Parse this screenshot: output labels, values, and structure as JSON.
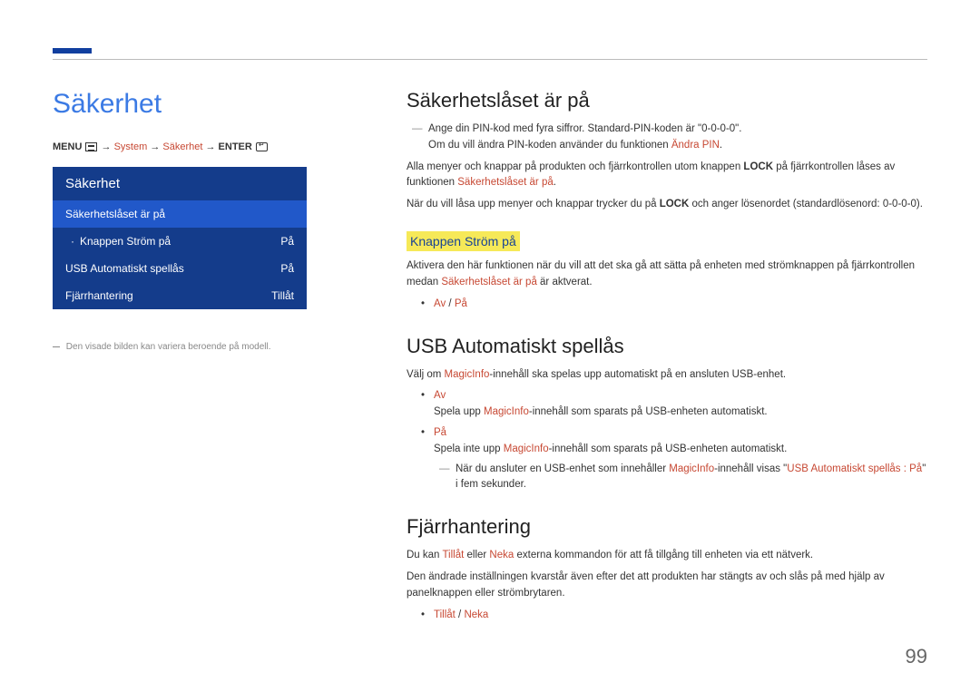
{
  "page": {
    "number": "99"
  },
  "left": {
    "heading": "Säkerhet",
    "breadcrumb": {
      "menu": "MENU",
      "arrow": " → ",
      "system": "System",
      "sakerhet": "Säkerhet",
      "enter": "ENTER"
    },
    "ui": {
      "title": "Säkerhet",
      "rows": {
        "lock_on": "Säkerhetslåset är på",
        "power_btn": {
          "label": "Knappen Ström på",
          "value": "På"
        },
        "usb": {
          "label": "USB Automatiskt spellås",
          "value": "På"
        },
        "remote": {
          "label": "Fjärrhantering",
          "value": "Tillåt"
        }
      }
    },
    "footnote": "Den visade bilden kan variera beroende på modell."
  },
  "right": {
    "section1": {
      "title": "Säkerhetslåset är på",
      "note1_part1": "Ange din PIN-kod med fyra siffror. Standard-PIN-koden är \"0-0-0-0\".",
      "note1_part2a": "Om du vill ändra PIN-koden använder du funktionen ",
      "note1_part2b": "Ändra PIN",
      "note1_part2c": ".",
      "p1a": "Alla menyer och knappar på produkten och fjärrkontrollen utom knappen ",
      "p1b": "LOCK",
      "p1c": " på fjärrkontrollen låses av funktionen ",
      "p1d": "Säkerhetslåset är på",
      "p1e": ".",
      "p2a": "När du vill låsa upp menyer och knappar trycker du på ",
      "p2b": "LOCK",
      "p2c": " och anger lösenordet (standardlösenord: 0-0-0-0).",
      "sub": {
        "title": "Knappen Ström på",
        "p1a": "Aktivera den här funktionen när du vill att det ska gå att sätta på enheten med strömknappen på fjärrkontrollen medan ",
        "p1b": "Säkerhetslåset är på",
        "p1c": " är aktverat.",
        "opts": {
          "av": "Av",
          "slash": " / ",
          "pa": "På"
        }
      }
    },
    "section2": {
      "title": "USB Automatiskt spellås",
      "p1a": "Välj om ",
      "p1b": "MagicInfo",
      "p1c": "-innehåll ska spelas upp automatiskt på en ansluten USB-enhet.",
      "item_av": {
        "label": "Av",
        "desc_a": "Spela upp ",
        "desc_b": "MagicInfo",
        "desc_c": "-innehåll som sparats på USB-enheten automatiskt."
      },
      "item_pa": {
        "label": "På",
        "desc_a": "Spela inte upp ",
        "desc_b": "MagicInfo",
        "desc_c": "-innehåll som sparats på USB-enheten automatiskt.",
        "note_a": "När du ansluter en USB-enhet som innehåller ",
        "note_b": "MagicInfo",
        "note_c": "-innehåll visas \"",
        "note_d": "USB Automatiskt spellås : På",
        "note_e": "\" i fem sekunder."
      }
    },
    "section3": {
      "title": "Fjärrhantering",
      "p1a": "Du kan ",
      "p1b": "Tillåt",
      "p1c": " eller ",
      "p1d": "Neka",
      "p1e": " externa kommandon för att få tillgång till enheten via ett nätverk.",
      "p2": "Den ändrade inställningen kvarstår även efter det att produkten har stängts av och slås på med hjälp av panelknappen eller strömbrytaren.",
      "opts": {
        "tillat": "Tillåt",
        "slash": " / ",
        "neka": "Neka"
      }
    }
  }
}
